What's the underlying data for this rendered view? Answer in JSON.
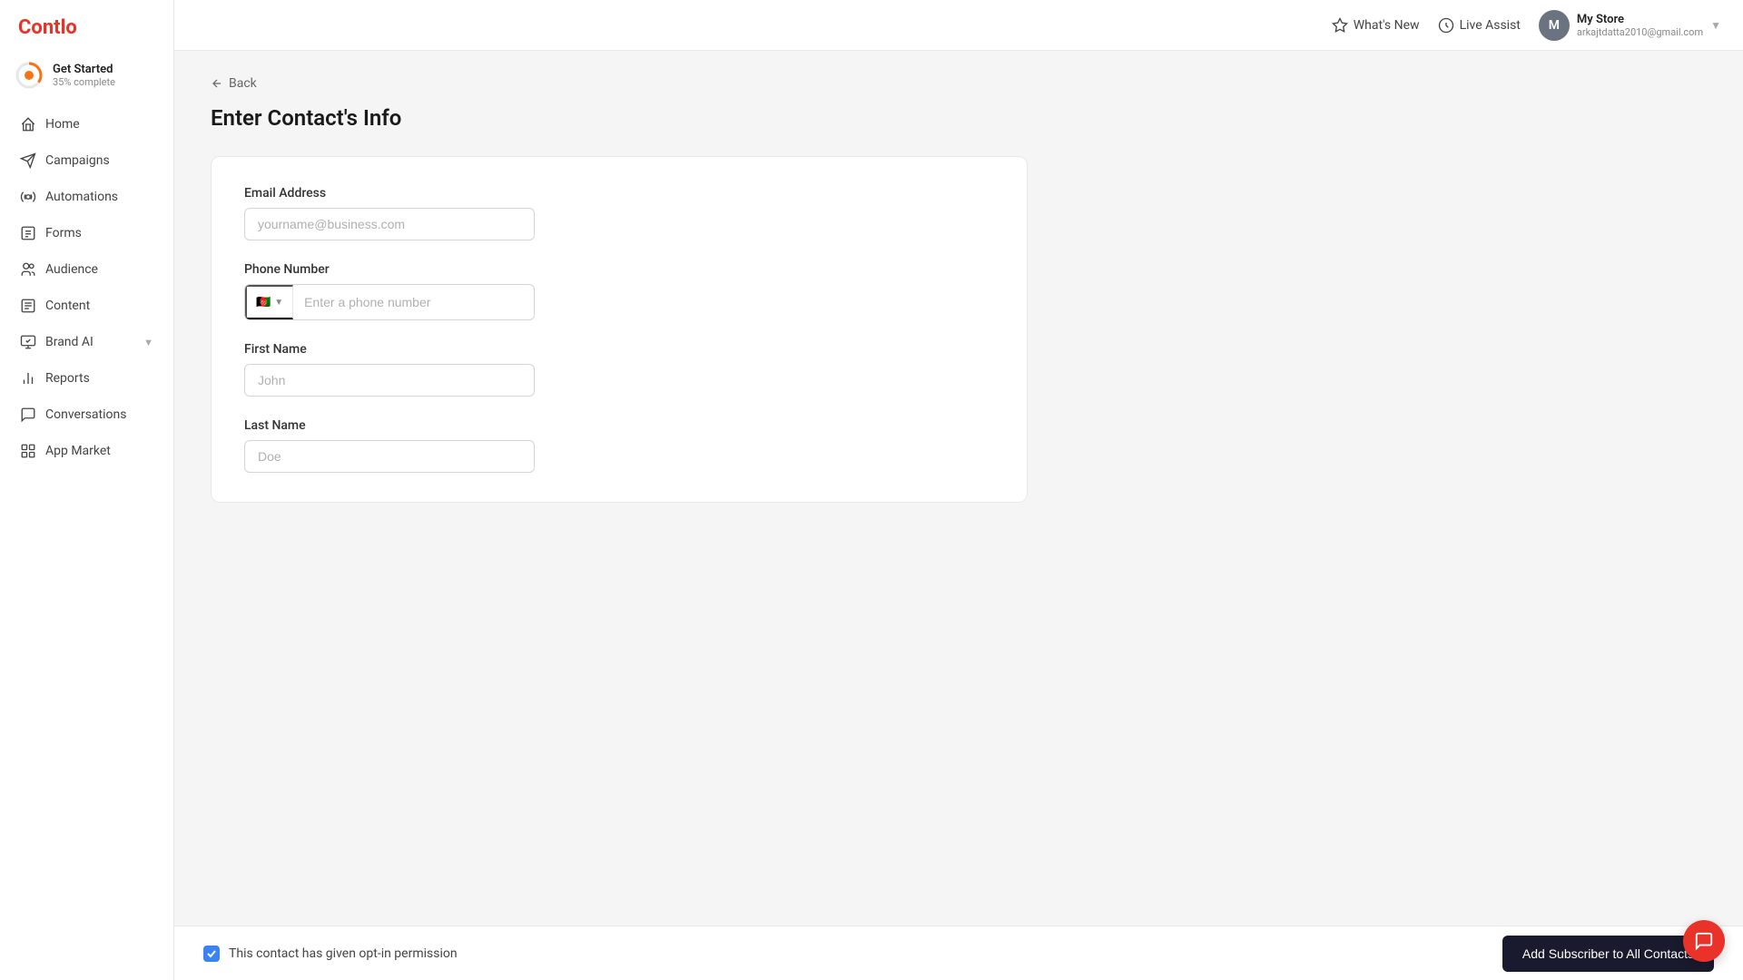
{
  "app": {
    "logo": "Contlo"
  },
  "sidebar": {
    "get_started": {
      "label": "Get Started",
      "progress_pct": "35% complete",
      "progress_value": 35
    },
    "nav_items": [
      {
        "id": "home",
        "label": "Home",
        "icon": "home-icon"
      },
      {
        "id": "campaigns",
        "label": "Campaigns",
        "icon": "campaigns-icon"
      },
      {
        "id": "automations",
        "label": "Automations",
        "icon": "automations-icon"
      },
      {
        "id": "forms",
        "label": "Forms",
        "icon": "forms-icon"
      },
      {
        "id": "audience",
        "label": "Audience",
        "icon": "audience-icon"
      },
      {
        "id": "content",
        "label": "Content",
        "icon": "content-icon"
      },
      {
        "id": "brand-ai",
        "label": "Brand AI",
        "icon": "brand-ai-icon",
        "has_arrow": true
      },
      {
        "id": "reports",
        "label": "Reports",
        "icon": "reports-icon"
      },
      {
        "id": "conversations",
        "label": "Conversations",
        "icon": "conversations-icon"
      },
      {
        "id": "app-market",
        "label": "App Market",
        "icon": "app-market-icon"
      }
    ]
  },
  "topbar": {
    "whats_new_label": "What's New",
    "live_assist_label": "Live Assist",
    "user": {
      "avatar_letter": "M",
      "name": "My Store",
      "email": "arkajtdatta2010@gmail.com"
    }
  },
  "page": {
    "back_label": "Back",
    "title": "Enter Contact's Info",
    "form": {
      "email_label": "Email Address",
      "email_placeholder": "yourname@business.com",
      "phone_label": "Phone Number",
      "phone_placeholder": "Enter a phone number",
      "phone_flag": "🇦🇫",
      "first_name_label": "First Name",
      "first_name_placeholder": "John",
      "last_name_label": "Last Name",
      "last_name_placeholder": "Doe"
    }
  },
  "bottom_bar": {
    "opt_in_label": "This contact has given opt-in permission",
    "add_btn_label": "Add Subscriber to All Contacts"
  }
}
